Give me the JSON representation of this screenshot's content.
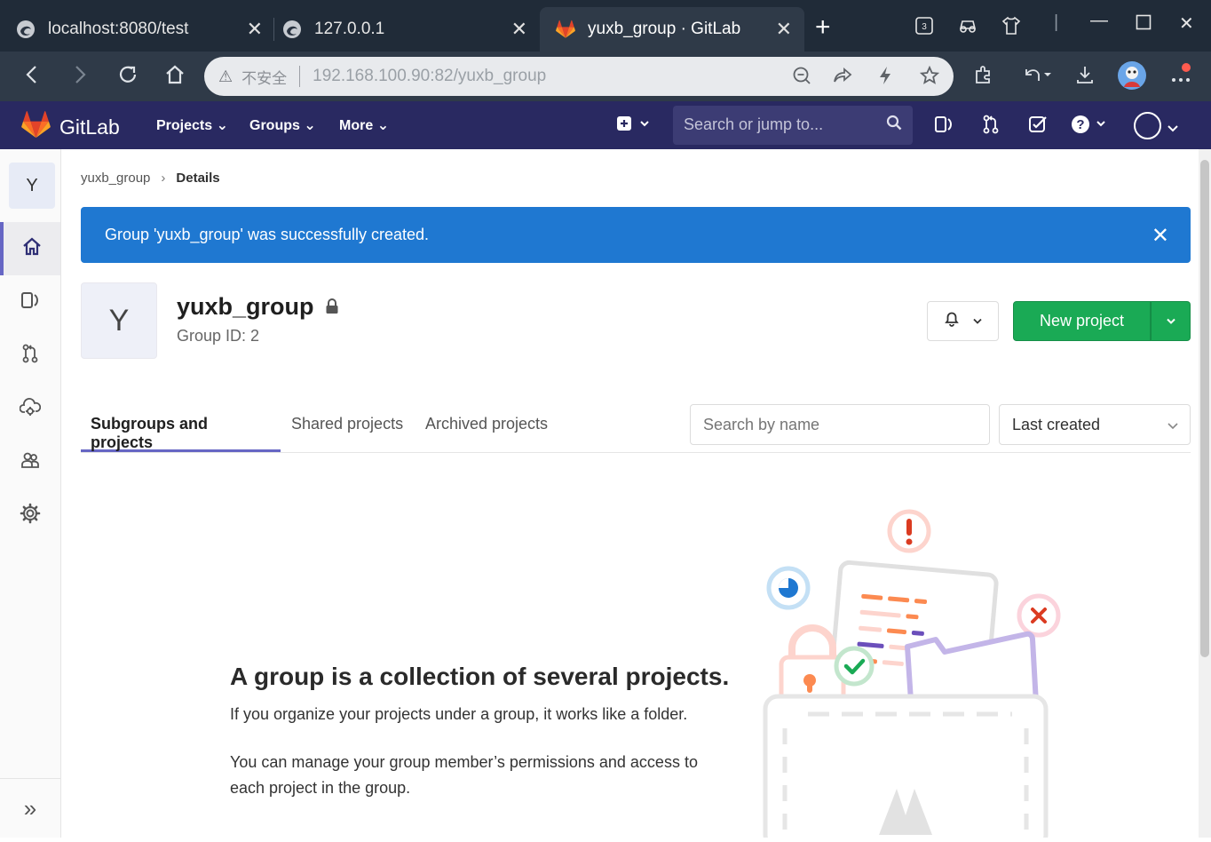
{
  "browser": {
    "tabs": [
      {
        "title": "localhost:8080/test",
        "active": false
      },
      {
        "title": "127.0.0.1",
        "active": false
      },
      {
        "title": "yuxb_group · GitLab",
        "active": true
      }
    ],
    "tab_count_badge": "3",
    "insecure_label": "不安全",
    "url": "192.168.100.90:82/yuxb_group"
  },
  "gitlab_nav": {
    "brand": "GitLab",
    "links": [
      "Projects",
      "Groups",
      "More"
    ],
    "search_placeholder": "Search or jump to..."
  },
  "sidebar": {
    "group_initial": "Y",
    "items": [
      "group-overview",
      "issues",
      "merge-requests",
      "kubernetes",
      "members",
      "settings"
    ]
  },
  "breadcrumb": {
    "items": [
      "yuxb_group",
      "Details"
    ]
  },
  "alert": {
    "message": "Group 'yuxb_group' was successfully created.",
    "color": "#1f78d1"
  },
  "group": {
    "initial": "Y",
    "name": "yuxb_group",
    "id_label": "Group ID: 2"
  },
  "actions": {
    "new_project_label": "New project",
    "primary_color": "#1aaa55"
  },
  "group_tabs": {
    "items": [
      "Subgroups and projects",
      "Shared projects",
      "Archived projects"
    ],
    "active_index": 0
  },
  "filter": {
    "search_placeholder": "Search by name",
    "sort_value": "Last created"
  },
  "empty_state": {
    "title": "A group is a collection of several projects.",
    "line1": "If you organize your projects under a group, it works like a folder.",
    "line2": "You can manage your group member’s permissions and access to each project in the group."
  },
  "colors": {
    "nav_bg": "#292961",
    "active_tab_underline": "#6666c4"
  }
}
